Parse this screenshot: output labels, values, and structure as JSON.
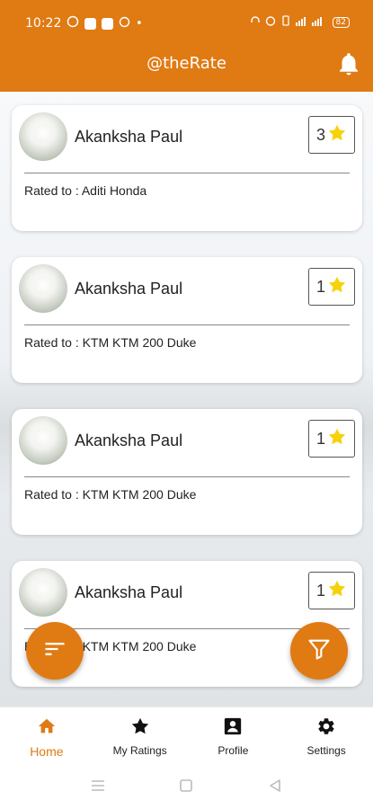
{
  "status": {
    "time": "10:22",
    "battery": "82"
  },
  "appbar": {
    "title": "@theRate",
    "bell_icon": "bell-icon"
  },
  "colors": {
    "brand": "#e07a13",
    "star": "#f5d20a"
  },
  "cards": [
    {
      "name": "Akanksha Paul",
      "rating": "3",
      "rated_to": "Rated to : Aditi Honda"
    },
    {
      "name": "Akanksha Paul",
      "rating": "1",
      "rated_to": "Rated to : KTM KTM 200 Duke"
    },
    {
      "name": "Akanksha Paul",
      "rating": "1",
      "rated_to": "Rated to : KTM KTM 200 Duke"
    },
    {
      "name": "Akanksha Paul",
      "rating": "1",
      "rated_to": "Rated to : KTM KTM 200 Duke"
    }
  ],
  "fabs": {
    "sort_icon": "sort-icon",
    "filter_icon": "filter-icon"
  },
  "bottom_nav": [
    {
      "label": "Home",
      "icon": "home-icon",
      "active": true
    },
    {
      "label": "My Ratings",
      "icon": "star-icon",
      "active": false
    },
    {
      "label": "Profile",
      "icon": "profile-icon",
      "active": false
    },
    {
      "label": "Settings",
      "icon": "gear-icon",
      "active": false
    }
  ]
}
